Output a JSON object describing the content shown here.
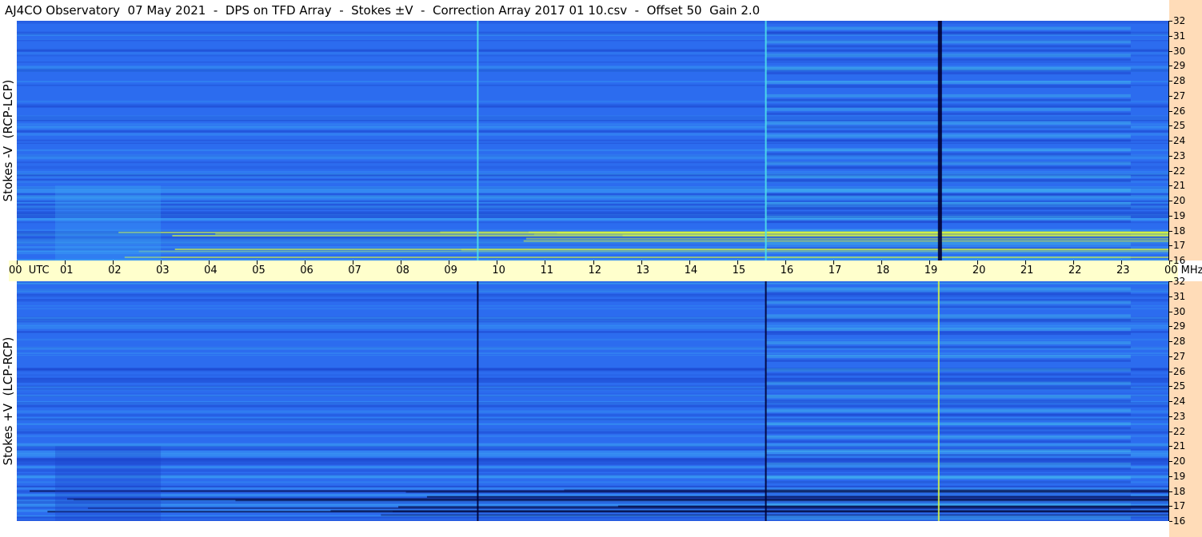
{
  "title": "AJ4CO Observatory  07 May 2021  -  DPS on TFD Array  -  Stokes ±V  -  Correction Array 2017 01 10.csv  -  Offset 50  Gain 2.0",
  "colors": {
    "background": "#2c6cef",
    "band_dark": "#1a3fc8",
    "band_light": "#3da7f5",
    "band_cyan": "#4fe0e8",
    "burst_yellow": "#d6f542",
    "line_black": "#000033",
    "axis_bg": "#ffffcc",
    "freq_strip_bg": "#ffdcb8"
  },
  "chart_data": [
    {
      "type": "heatmap",
      "panel": "top",
      "ylabel": "Stokes -V  (RCP-LCP)",
      "x_unit": "UTC hour",
      "xlim": [
        0,
        24
      ],
      "y_unit": "MHz",
      "ylim": [
        16,
        32
      ],
      "yticks": [
        "16",
        "17",
        "18",
        "19",
        "20",
        "21",
        "22",
        "23",
        "24",
        "25",
        "26",
        "27",
        "28",
        "29",
        "30",
        "31",
        "32"
      ],
      "vertical_lines": [
        {
          "x": 9.6,
          "color": "cyan"
        },
        {
          "x": 15.6,
          "color": "cyan"
        },
        {
          "x": 19.2,
          "color": "black"
        }
      ]
    },
    {
      "type": "heatmap",
      "panel": "bottom",
      "ylabel": "Stokes +V  (LCP-RCP)",
      "x_unit": "UTC hour",
      "xlim": [
        0,
        24
      ],
      "y_unit": "MHz",
      "ylim": [
        16,
        32
      ],
      "yticks": [
        "16",
        "17",
        "18",
        "19",
        "20",
        "21",
        "22",
        "23",
        "24",
        "25",
        "26",
        "27",
        "28",
        "29",
        "30",
        "31",
        "32"
      ],
      "vertical_lines": [
        {
          "x": 9.6,
          "color": "black"
        },
        {
          "x": 15.6,
          "color": "black"
        },
        {
          "x": 19.2,
          "color": "yellow"
        }
      ]
    }
  ],
  "time_axis": {
    "labels": [
      "00  UTC",
      "01",
      "02",
      "03",
      "04",
      "05",
      "06",
      "07",
      "08",
      "09",
      "10",
      "11",
      "12",
      "13",
      "14",
      "15",
      "16",
      "17",
      "18",
      "19",
      "20",
      "21",
      "22",
      "23",
      "00 MHz"
    ]
  }
}
